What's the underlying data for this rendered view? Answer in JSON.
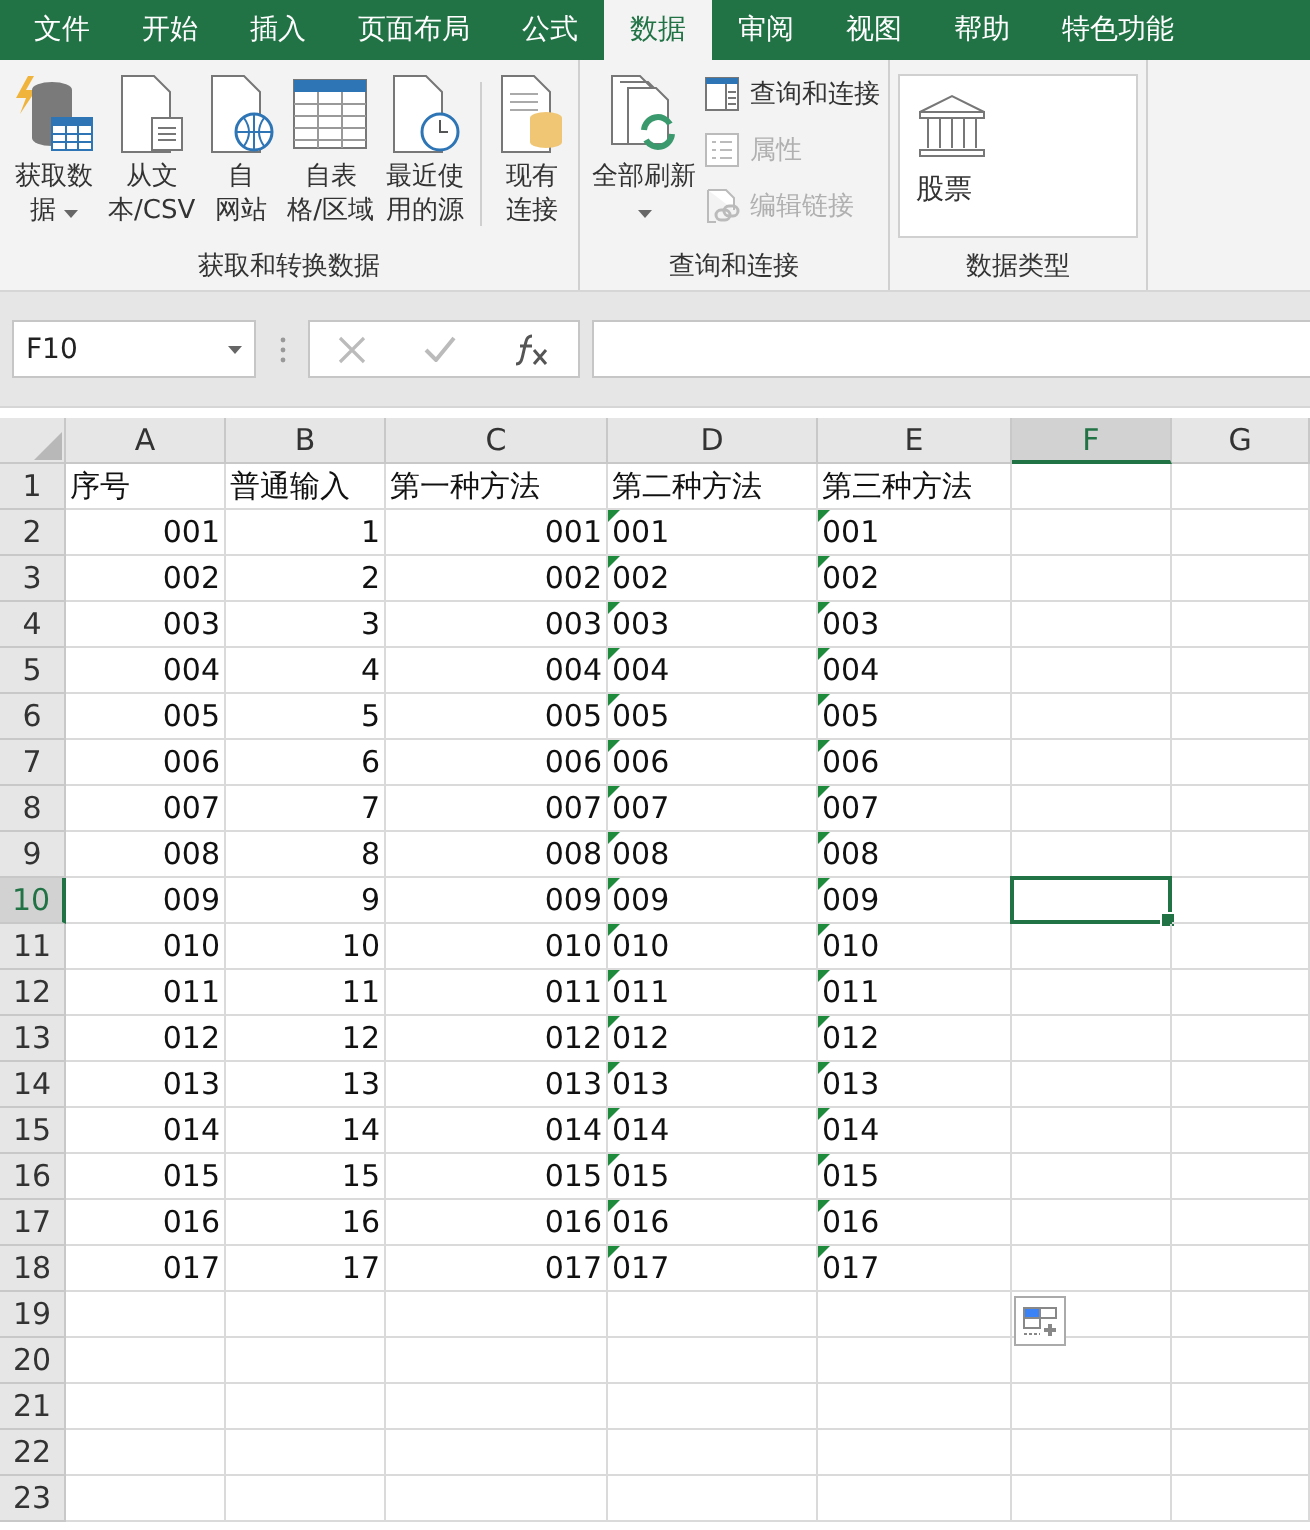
{
  "tabs": [
    {
      "label": "文件",
      "selected": false
    },
    {
      "label": "开始",
      "selected": false
    },
    {
      "label": "插入",
      "selected": false
    },
    {
      "label": "页面布局",
      "selected": false
    },
    {
      "label": "公式",
      "selected": false
    },
    {
      "label": "数据",
      "selected": true
    },
    {
      "label": "审阅",
      "selected": false
    },
    {
      "label": "视图",
      "selected": false
    },
    {
      "label": "帮助",
      "selected": false
    },
    {
      "label": "特色功能",
      "selected": false
    }
  ],
  "ribbon": {
    "groups": [
      {
        "label": "获取和转换数据",
        "items": [
          {
            "kind": "large",
            "lines": [
              "获取数",
              "据"
            ],
            "dropdown": true
          },
          {
            "kind": "large",
            "lines": [
              "从文",
              "本/CSV"
            ],
            "dropdown": false
          },
          {
            "kind": "large",
            "lines": [
              "自",
              "网站"
            ],
            "dropdown": false
          },
          {
            "kind": "large",
            "lines": [
              "自表",
              "格/区域"
            ],
            "dropdown": false
          },
          {
            "kind": "large",
            "lines": [
              "最近使",
              "用的源"
            ],
            "dropdown": false
          },
          {
            "kind": "separator"
          },
          {
            "kind": "large",
            "lines": [
              "现有",
              "连接"
            ],
            "dropdown": false
          }
        ]
      },
      {
        "label": "查询和连接",
        "items": [
          {
            "kind": "large",
            "lines": [
              "全部刷新"
            ],
            "dropdown": true
          },
          {
            "kind": "small",
            "label": "查询和连接",
            "disabled": false
          },
          {
            "kind": "small",
            "label": "属性",
            "disabled": true
          },
          {
            "kind": "small",
            "label": "编辑链接",
            "disabled": true
          }
        ]
      },
      {
        "label": "数据类型",
        "items": [
          {
            "kind": "gallery",
            "label": "股票"
          }
        ]
      }
    ]
  },
  "formula_bar": {
    "name_box": "F10"
  },
  "columns": [
    {
      "label": "A",
      "selected": false
    },
    {
      "label": "B",
      "selected": false
    },
    {
      "label": "C",
      "selected": false
    },
    {
      "label": "D",
      "selected": false
    },
    {
      "label": "E",
      "selected": false
    },
    {
      "label": "F",
      "selected": true
    },
    {
      "label": "G",
      "selected": false
    }
  ],
  "rows": [
    {
      "label": "1",
      "selected": false,
      "cells": [
        {
          "kind": "label",
          "text": "序号"
        },
        {
          "kind": "label",
          "text": "普通输入"
        },
        {
          "kind": "label",
          "text": "第一种方法"
        },
        {
          "kind": "label",
          "text": "第二种方法"
        },
        {
          "kind": "label",
          "text": "第三种方法"
        }
      ]
    },
    {
      "label": "2",
      "selected": false,
      "cells": [
        {
          "kind": "number",
          "text": "001"
        },
        {
          "kind": "number",
          "text": "1"
        },
        {
          "kind": "number",
          "text": "001"
        },
        {
          "kind": "text",
          "text": "001"
        },
        {
          "kind": "text",
          "text": "001"
        }
      ]
    },
    {
      "label": "3",
      "selected": false,
      "cells": [
        {
          "kind": "number",
          "text": "002"
        },
        {
          "kind": "number",
          "text": "2"
        },
        {
          "kind": "number",
          "text": "002"
        },
        {
          "kind": "text",
          "text": "002"
        },
        {
          "kind": "text",
          "text": "002"
        }
      ]
    },
    {
      "label": "4",
      "selected": false,
      "cells": [
        {
          "kind": "number",
          "text": "003"
        },
        {
          "kind": "number",
          "text": "3"
        },
        {
          "kind": "number",
          "text": "003"
        },
        {
          "kind": "text",
          "text": "003"
        },
        {
          "kind": "text",
          "text": "003"
        }
      ]
    },
    {
      "label": "5",
      "selected": false,
      "cells": [
        {
          "kind": "number",
          "text": "004"
        },
        {
          "kind": "number",
          "text": "4"
        },
        {
          "kind": "number",
          "text": "004"
        },
        {
          "kind": "text",
          "text": "004"
        },
        {
          "kind": "text",
          "text": "004"
        }
      ]
    },
    {
      "label": "6",
      "selected": false,
      "cells": [
        {
          "kind": "number",
          "text": "005"
        },
        {
          "kind": "number",
          "text": "5"
        },
        {
          "kind": "number",
          "text": "005"
        },
        {
          "kind": "text",
          "text": "005"
        },
        {
          "kind": "text",
          "text": "005"
        }
      ]
    },
    {
      "label": "7",
      "selected": false,
      "cells": [
        {
          "kind": "number",
          "text": "006"
        },
        {
          "kind": "number",
          "text": "6"
        },
        {
          "kind": "number",
          "text": "006"
        },
        {
          "kind": "text",
          "text": "006"
        },
        {
          "kind": "text",
          "text": "006"
        }
      ]
    },
    {
      "label": "8",
      "selected": false,
      "cells": [
        {
          "kind": "number",
          "text": "007"
        },
        {
          "kind": "number",
          "text": "7"
        },
        {
          "kind": "number",
          "text": "007"
        },
        {
          "kind": "text",
          "text": "007"
        },
        {
          "kind": "text",
          "text": "007"
        }
      ]
    },
    {
      "label": "9",
      "selected": false,
      "cells": [
        {
          "kind": "number",
          "text": "008"
        },
        {
          "kind": "number",
          "text": "8"
        },
        {
          "kind": "number",
          "text": "008"
        },
        {
          "kind": "text",
          "text": "008"
        },
        {
          "kind": "text",
          "text": "008"
        }
      ]
    },
    {
      "label": "10",
      "selected": true,
      "cells": [
        {
          "kind": "number",
          "text": "009"
        },
        {
          "kind": "number",
          "text": "9"
        },
        {
          "kind": "number",
          "text": "009"
        },
        {
          "kind": "text",
          "text": "009"
        },
        {
          "kind": "text",
          "text": "009"
        }
      ]
    },
    {
      "label": "11",
      "selected": false,
      "cells": [
        {
          "kind": "number",
          "text": "010"
        },
        {
          "kind": "number",
          "text": "10"
        },
        {
          "kind": "number",
          "text": "010"
        },
        {
          "kind": "text",
          "text": "010"
        },
        {
          "kind": "text",
          "text": "010"
        }
      ]
    },
    {
      "label": "12",
      "selected": false,
      "cells": [
        {
          "kind": "number",
          "text": "011"
        },
        {
          "kind": "number",
          "text": "11"
        },
        {
          "kind": "number",
          "text": "011"
        },
        {
          "kind": "text",
          "text": "011"
        },
        {
          "kind": "text",
          "text": "011"
        }
      ]
    },
    {
      "label": "13",
      "selected": false,
      "cells": [
        {
          "kind": "number",
          "text": "012"
        },
        {
          "kind": "number",
          "text": "12"
        },
        {
          "kind": "number",
          "text": "012"
        },
        {
          "kind": "text",
          "text": "012"
        },
        {
          "kind": "text",
          "text": "012"
        }
      ]
    },
    {
      "label": "14",
      "selected": false,
      "cells": [
        {
          "kind": "number",
          "text": "013"
        },
        {
          "kind": "number",
          "text": "13"
        },
        {
          "kind": "number",
          "text": "013"
        },
        {
          "kind": "text",
          "text": "013"
        },
        {
          "kind": "text",
          "text": "013"
        }
      ]
    },
    {
      "label": "15",
      "selected": false,
      "cells": [
        {
          "kind": "number",
          "text": "014"
        },
        {
          "kind": "number",
          "text": "14"
        },
        {
          "kind": "number",
          "text": "014"
        },
        {
          "kind": "text",
          "text": "014"
        },
        {
          "kind": "text",
          "text": "014"
        }
      ]
    },
    {
      "label": "16",
      "selected": false,
      "cells": [
        {
          "kind": "number",
          "text": "015"
        },
        {
          "kind": "number",
          "text": "15"
        },
        {
          "kind": "number",
          "text": "015"
        },
        {
          "kind": "text",
          "text": "015"
        },
        {
          "kind": "text",
          "text": "015"
        }
      ]
    },
    {
      "label": "17",
      "selected": false,
      "cells": [
        {
          "kind": "number",
          "text": "016"
        },
        {
          "kind": "number",
          "text": "16"
        },
        {
          "kind": "number",
          "text": "016"
        },
        {
          "kind": "text",
          "text": "016"
        },
        {
          "kind": "text",
          "text": "016"
        }
      ]
    },
    {
      "label": "18",
      "selected": false,
      "cells": [
        {
          "kind": "number",
          "text": "017"
        },
        {
          "kind": "number",
          "text": "17"
        },
        {
          "kind": "number",
          "text": "017"
        },
        {
          "kind": "text",
          "text": "017"
        },
        {
          "kind": "text",
          "text": "017"
        }
      ]
    },
    {
      "label": "19",
      "selected": false
    },
    {
      "label": "20",
      "selected": false
    },
    {
      "label": "21",
      "selected": false
    },
    {
      "label": "22",
      "selected": false
    },
    {
      "label": "23",
      "selected": false
    }
  ]
}
